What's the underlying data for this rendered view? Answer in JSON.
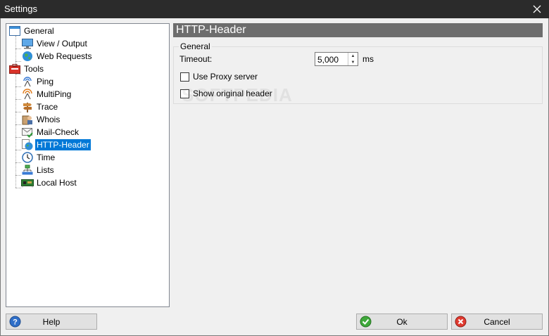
{
  "window": {
    "title": "Settings",
    "close_icon": "close-icon"
  },
  "tree": [
    {
      "label": "General",
      "icon": "window-icon",
      "level": 0
    },
    {
      "label": "View / Output",
      "icon": "monitor-icon",
      "level": 1
    },
    {
      "label": "Web Requests",
      "icon": "globe-icon",
      "level": 1
    },
    {
      "label": "Tools",
      "icon": "toolbox-icon",
      "level": 0
    },
    {
      "label": "Ping",
      "icon": "antenna-icon",
      "level": 1
    },
    {
      "label": "MultiPing",
      "icon": "multi-antenna-icon",
      "level": 1
    },
    {
      "label": "Trace",
      "icon": "signpost-icon",
      "level": 1
    },
    {
      "label": "Whois",
      "icon": "whois-icon",
      "level": 1
    },
    {
      "label": "Mail-Check",
      "icon": "mail-check-icon",
      "level": 1
    },
    {
      "label": "HTTP-Header",
      "icon": "http-globe-icon",
      "level": 1,
      "selected": true
    },
    {
      "label": "Time",
      "icon": "clock-icon",
      "level": 1
    },
    {
      "label": "Lists",
      "icon": "list-network-icon",
      "level": 1
    },
    {
      "label": "Local Host",
      "icon": "network-card-icon",
      "level": 1
    }
  ],
  "panel": {
    "header": "HTTP-Header",
    "group_title": "General",
    "timeout_label": "Timeout:",
    "timeout_value": "5,000",
    "timeout_unit": "ms",
    "use_proxy_label": "Use Proxy server",
    "use_proxy_checked": false,
    "show_original_label": "Show original header",
    "show_original_checked": false
  },
  "watermark": "SOFTPEDIA",
  "buttons": {
    "help": "Help",
    "ok": "Ok",
    "cancel": "Cancel"
  },
  "colors": {
    "selection": "#0078d7",
    "panel_header": "#6d6d6d",
    "titlebar": "#2b2b2b"
  }
}
